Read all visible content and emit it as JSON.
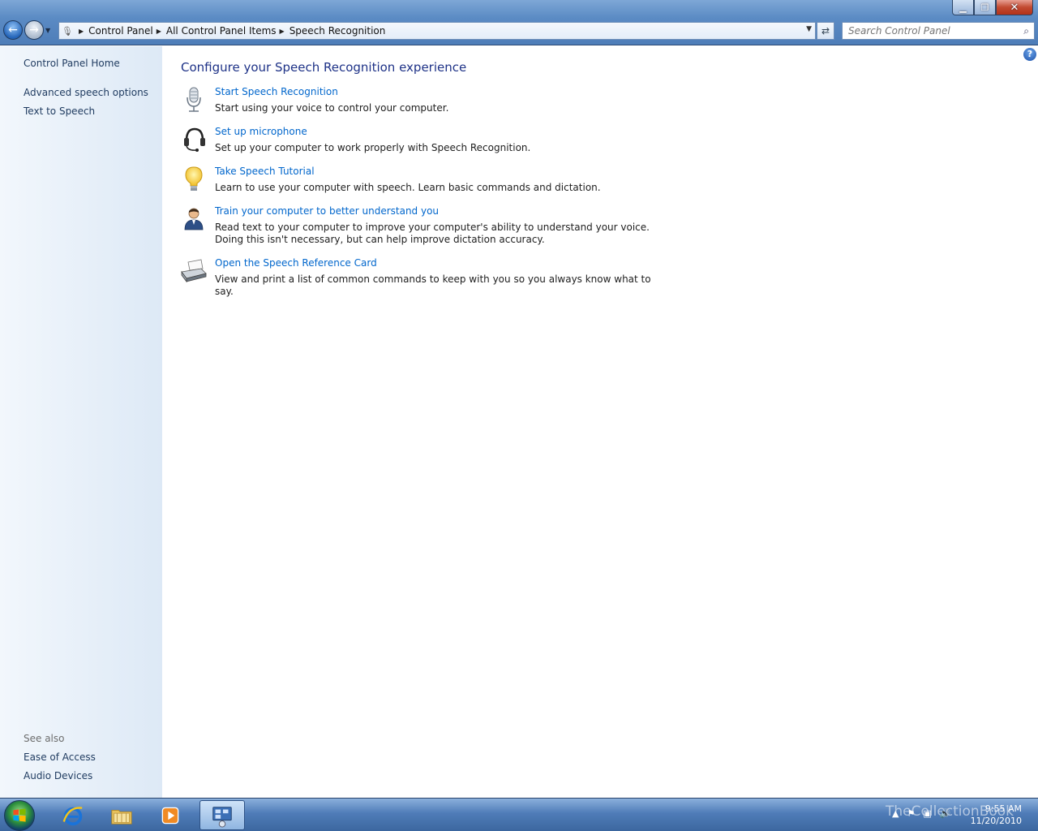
{
  "window": {
    "controls": {
      "minimize": "▁",
      "maximize": "❐",
      "close": "✕"
    }
  },
  "address": {
    "crumbs": [
      "Control Panel",
      "All Control Panel Items",
      "Speech Recognition"
    ]
  },
  "search": {
    "placeholder": "Search Control Panel"
  },
  "sidebar": {
    "home": "Control Panel Home",
    "items": [
      "Advanced speech options",
      "Text to Speech"
    ],
    "see_also_label": "See also",
    "see_also": [
      "Ease of Access",
      "Audio Devices"
    ]
  },
  "main": {
    "title": "Configure your Speech Recognition experience",
    "tasks": [
      {
        "link": "Start Speech Recognition",
        "desc": "Start using your voice to control your computer.",
        "icon": "microphone-icon"
      },
      {
        "link": "Set up microphone",
        "desc": "Set up your computer to work properly with Speech Recognition.",
        "icon": "headset-icon"
      },
      {
        "link": "Take Speech Tutorial",
        "desc": "Learn to use your computer with speech.  Learn basic commands and dictation.",
        "icon": "lightbulb-icon"
      },
      {
        "link": "Train your computer to better understand you",
        "desc": "Read text to your computer to improve your computer's ability to understand your voice.  Doing this isn't necessary, but can help improve dictation accuracy.",
        "icon": "user-icon"
      },
      {
        "link": "Open the Speech Reference Card",
        "desc": "View and print a list of common commands to keep with you so you always know what to say.",
        "icon": "printer-icon"
      }
    ]
  },
  "taskbar": {
    "watermark": "TheCollectionBook",
    "time": "9:55 AM",
    "date": "11/20/2010"
  },
  "colors": {
    "link": "#0066cc",
    "title": "#1e3287",
    "sidebar_link": "#1e3a5f"
  }
}
